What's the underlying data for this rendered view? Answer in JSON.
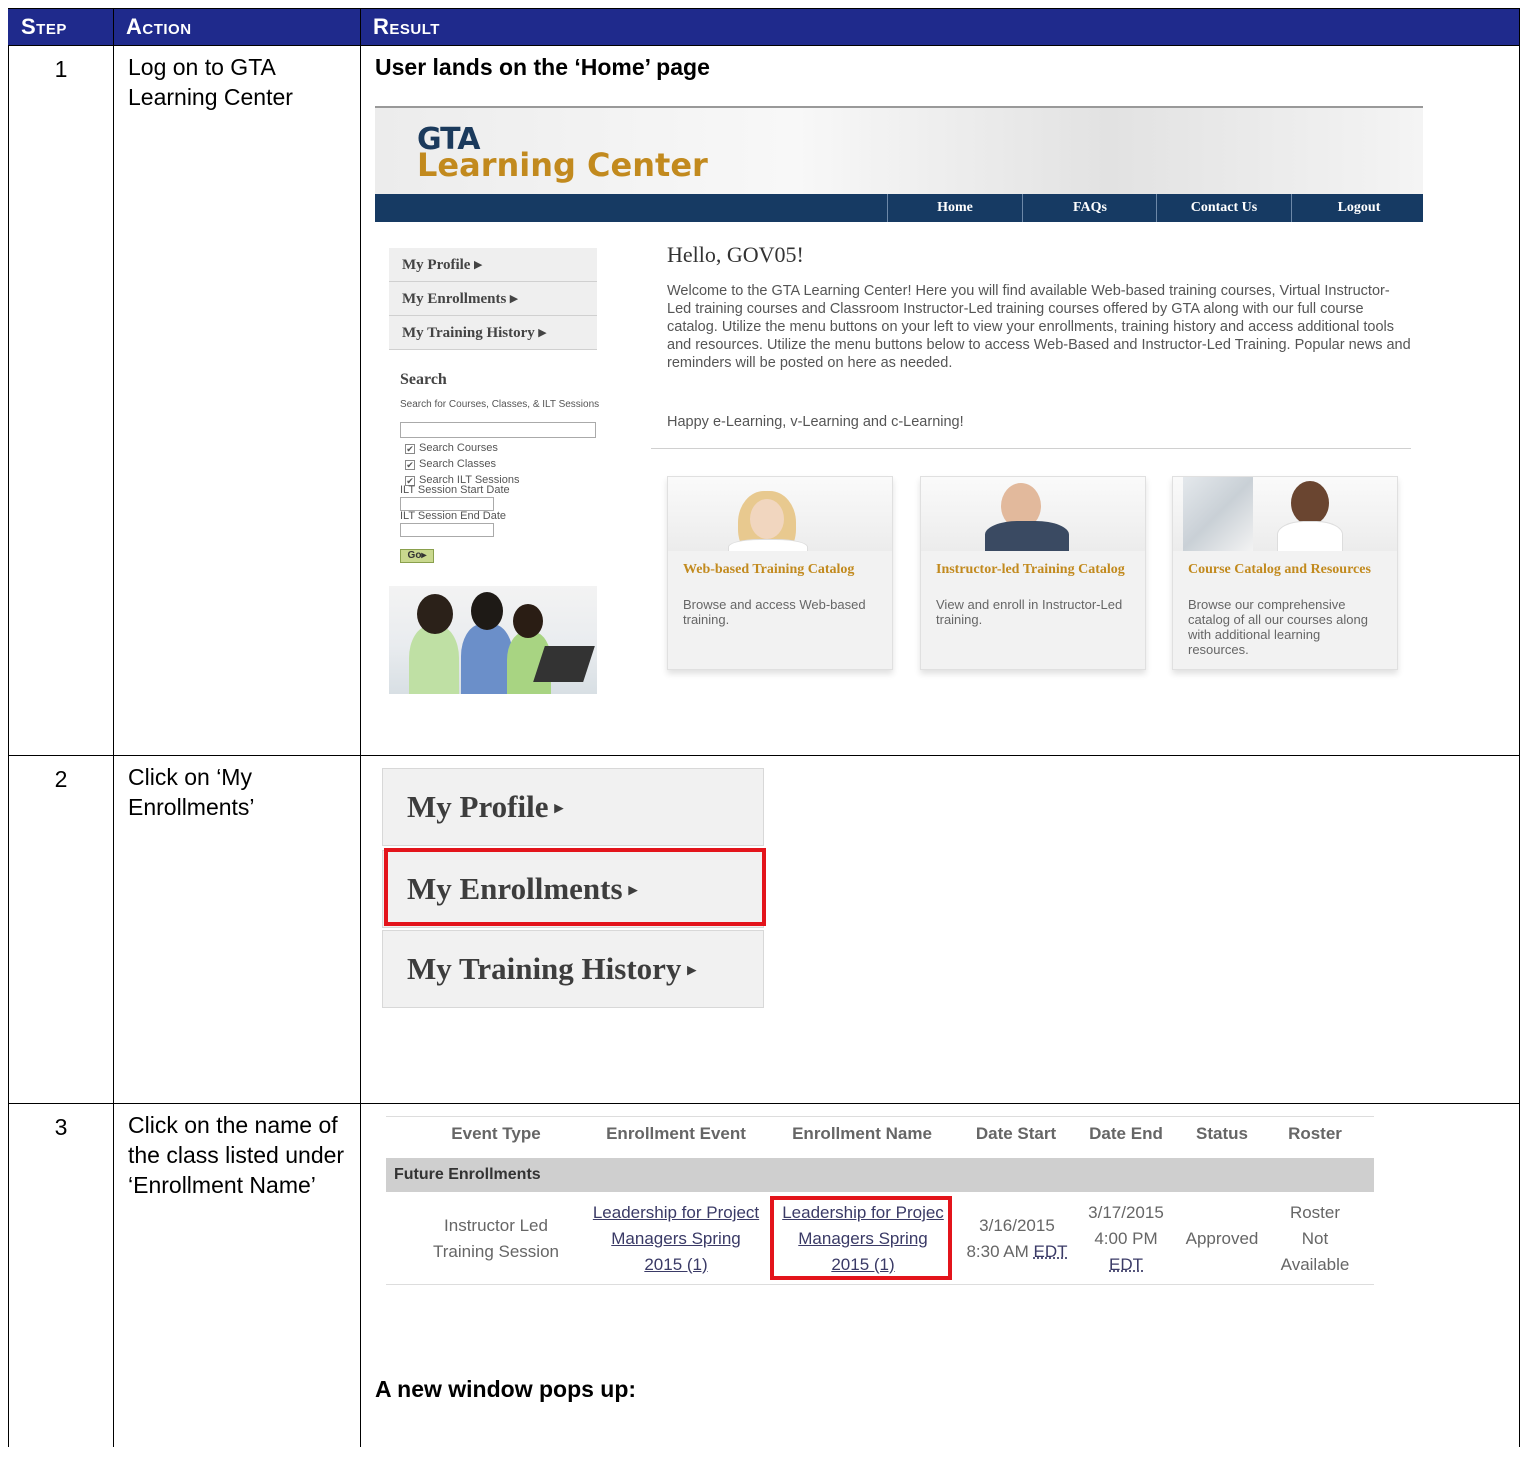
{
  "headers": {
    "step": "Step",
    "action": "Action",
    "result": "Result"
  },
  "rows": [
    {
      "step": "1",
      "action": "Log on to GTA Learning Center",
      "result_text": "User lands on the ‘Home’ page"
    },
    {
      "step": "2",
      "action": "Click on ‘My Enrollments’"
    },
    {
      "step": "3",
      "action": "Click on the name of the class listed under ‘Enrollment Name’",
      "result_text_bottom": "A new window pops up:"
    }
  ],
  "gta": {
    "logo_top": "GTA",
    "logo_bottom": "Learning Center",
    "nav": [
      "Home",
      "FAQs",
      "Contact Us",
      "Logout"
    ],
    "side_menu": [
      "My Profile ▸",
      "My Enrollments ▸",
      "My Training History ▸"
    ],
    "search": {
      "title": "Search",
      "label": "Search for Courses, Classes, & ILT Sessions",
      "checks": [
        "Search Courses",
        "Search Classes",
        "Search ILT Sessions"
      ],
      "start_label": "ILT Session Start Date",
      "end_label": "ILT Session End Date",
      "go": "Go▸"
    },
    "hello": "Hello, GOV05!",
    "welcome": "Welcome to the GTA Learning Center! Here you will find available Web-based training courses, Virtual Instructor-Led training courses and Classroom Instructor-Led training courses offered by GTA along with our full course catalog. Utilize the menu buttons on your left to view your enrollments, training history  and access additional tools and resources. Utilize the menu buttons below to access Web-Based and Instructor-Led Training. Popular news and reminders will be posted on here as needed.",
    "happy": "Happy e-Learning, v-Learning and c-Learning!",
    "cards": [
      {
        "title": "Web-based Training Catalog",
        "desc": "Browse and access Web-based training."
      },
      {
        "title": "Instructor-led Training Catalog",
        "desc": "View and enroll in Instructor-Led training."
      },
      {
        "title": "Course Catalog and Resources",
        "desc": "Browse our comprehensive catalog of all our courses along with additional learning resources."
      }
    ]
  },
  "zoom_menu": {
    "items": [
      "My Profile",
      "My Enrollments",
      "My Training History"
    ],
    "arrow": "▸"
  },
  "enrollments": {
    "headers": [
      "Event Type",
      "Enrollment Event",
      "Enrollment Name",
      "Date Start",
      "Date End",
      "Status",
      "Roster"
    ],
    "section": "Future Enrollments",
    "row": {
      "event_type": "Instructor Led Training Session",
      "event_line1": "Leadership for Project",
      "event_line2": "Managers Spring",
      "event_line3": "2015 (1)",
      "name_line1": "Leadership for Projec",
      "name_line2": "Managers Spring",
      "name_line3": "2015 (1)",
      "date_start": "3/16/2015",
      "time_start": "8:30 AM",
      "tz_start": "EDT",
      "date_end": "3/17/2015",
      "time_end": "4:00 PM",
      "tz_end": "EDT",
      "status": "Approved",
      "roster_line1": "Roster",
      "roster_line2": "Not",
      "roster_line3": "Available"
    }
  },
  "colors": {
    "header_bg": "#1f2a8c",
    "nav_bg": "#163a63",
    "gold": "#c28a1e",
    "highlight": "#e3141b"
  }
}
